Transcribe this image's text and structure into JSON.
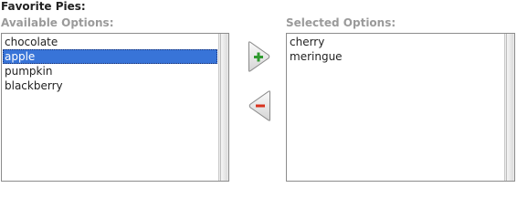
{
  "title": "Favorite Pies:",
  "available": {
    "label": "Available Options:",
    "items": [
      "chocolate",
      "apple",
      "pumpkin",
      "blackberry"
    ],
    "selected_item": "apple"
  },
  "selected": {
    "label": "Selected Options:",
    "items": [
      "cherry",
      "meringue"
    ]
  },
  "buttons": {
    "add_icon": "plus-icon",
    "remove_icon": "minus-icon"
  },
  "colors": {
    "selection": "#3874d8",
    "add": "#2f9a2f",
    "remove": "#d8321e"
  }
}
